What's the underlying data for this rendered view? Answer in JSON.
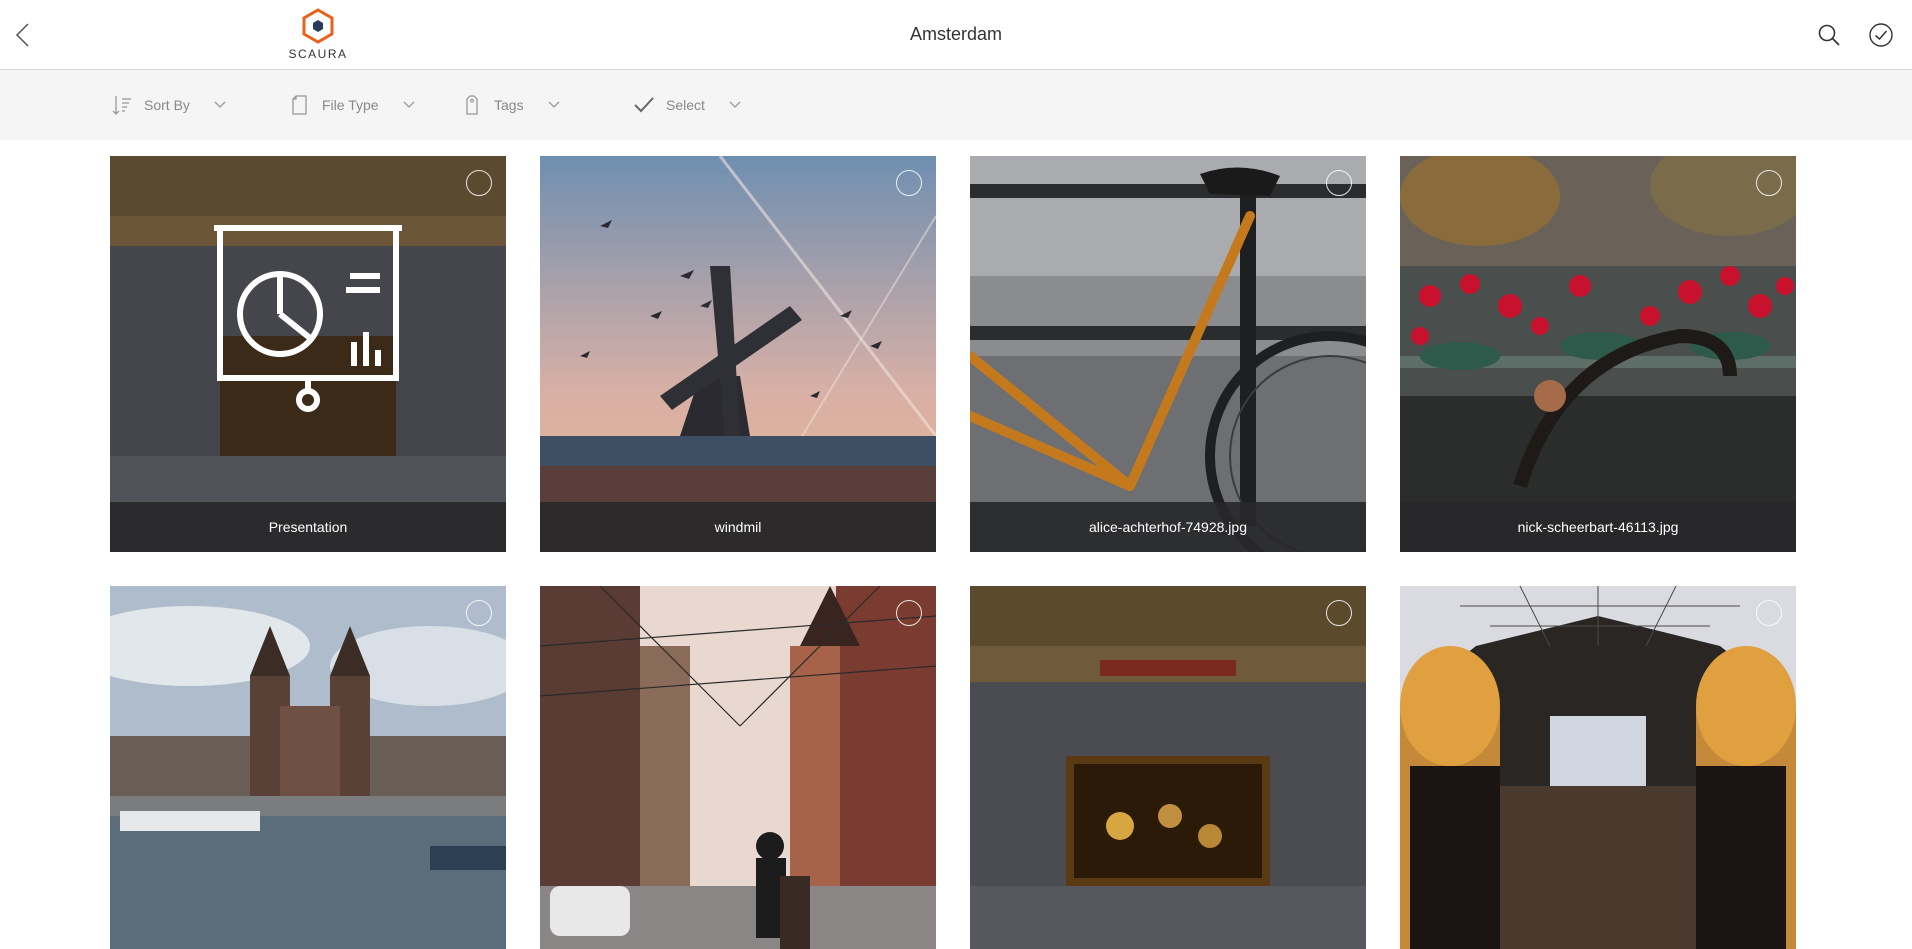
{
  "header": {
    "back_label": "Back",
    "logo_text": "SCAURA",
    "title": "Amsterdam",
    "search_icon": "search-icon",
    "done_icon": "check-circle-icon"
  },
  "toolbar": {
    "sort_label": "Sort By",
    "filetype_label": "File Type",
    "tags_label": "Tags",
    "select_label": "Select"
  },
  "colors": {
    "brand_orange": "#e8621e",
    "caption_bg": "#28282a",
    "toolbar_bg": "#f5f5f5"
  },
  "tiles": [
    {
      "caption": "Presentation",
      "kind": "presentation"
    },
    {
      "caption": "windmil",
      "kind": "windmill"
    },
    {
      "caption": "alice-achterhof-74928.jpg",
      "kind": "bicycle"
    },
    {
      "caption": "nick-scheerbart-46113.jpg",
      "kind": "flowers"
    },
    {
      "caption": "",
      "kind": "church"
    },
    {
      "caption": "",
      "kind": "street"
    },
    {
      "caption": "",
      "kind": "rembrandt"
    },
    {
      "caption": "",
      "kind": "library"
    }
  ]
}
